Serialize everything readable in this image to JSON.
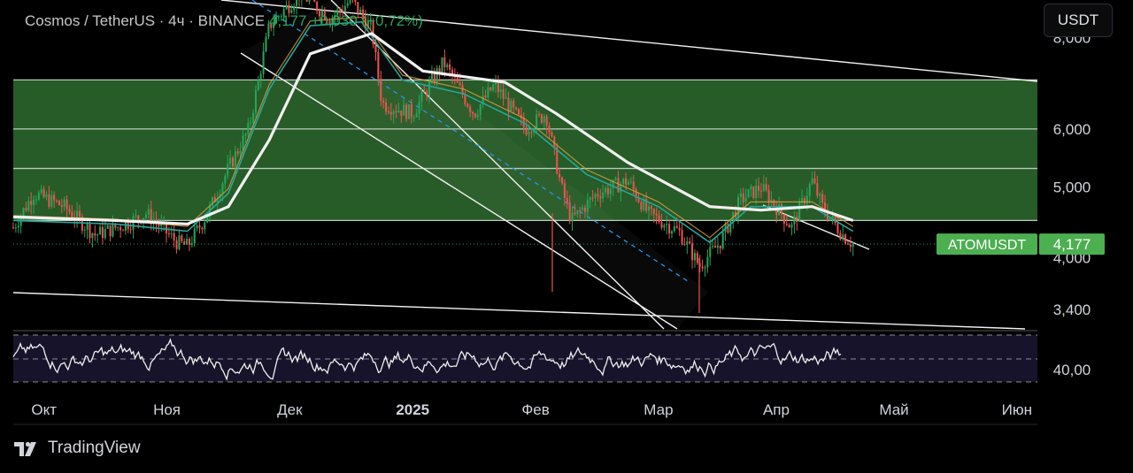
{
  "header": {
    "symbol": "Cosmos / TetherUS · 4ч · BINANCE",
    "last": "4,177",
    "change": "+0,030 (+0,72%)"
  },
  "currency_button": "USDT",
  "branding": "TradingView",
  "colors": {
    "background": "#000000",
    "zone_fill": "#2e6b2e",
    "up": "#26a65b",
    "down": "#ef5350",
    "ma_slow": "#f0f0f0",
    "ma_fast": "#26a69a",
    "ma_mid": "#e0a040",
    "trend_dashed": "#2196f3",
    "price_label": "#4caf50"
  },
  "chart_data": {
    "type": "line",
    "symbol_label": "ATOMUSDT",
    "last_price_label": "4,177",
    "y_axis_ticks": [
      "8,000",
      "6,000",
      "5,000",
      "4,000",
      "3,400"
    ],
    "y_ticks_values": [
      8000,
      6000,
      5000,
      4000,
      3400
    ],
    "ylim": [
      3200,
      9000
    ],
    "log_scale": true,
    "x_axis_ticks": [
      "Окт",
      "Ноя",
      "Дек",
      "2025",
      "Фев",
      "Мар",
      "Апр",
      "Май",
      "Июн"
    ],
    "x_ticks_t": [
      0.03,
      0.15,
      0.27,
      0.39,
      0.51,
      0.63,
      0.745,
      0.86,
      0.98
    ],
    "indicator": {
      "name": "RSI",
      "tick_label": "40,00",
      "tick_value": 40
    },
    "zones": [
      {
        "from": 4500,
        "to": 5300
      },
      {
        "from": 5300,
        "to": 6000
      },
      {
        "from": 6000,
        "to": 7000
      }
    ],
    "key_points": [
      {
        "t": 0.0,
        "p": 4400
      },
      {
        "t": 0.02,
        "p": 4900
      },
      {
        "t": 0.05,
        "p": 4700
      },
      {
        "t": 0.08,
        "p": 4300
      },
      {
        "t": 0.11,
        "p": 4450
      },
      {
        "t": 0.13,
        "p": 4600
      },
      {
        "t": 0.16,
        "p": 4200
      },
      {
        "t": 0.17,
        "p": 4150
      },
      {
        "t": 0.19,
        "p": 4600
      },
      {
        "t": 0.21,
        "p": 5300
      },
      {
        "t": 0.23,
        "p": 6000
      },
      {
        "t": 0.25,
        "p": 8300
      },
      {
        "t": 0.28,
        "p": 9200
      },
      {
        "t": 0.31,
        "p": 8500
      },
      {
        "t": 0.33,
        "p": 9000
      },
      {
        "t": 0.35,
        "p": 8200
      },
      {
        "t": 0.36,
        "p": 6500
      },
      {
        "t": 0.39,
        "p": 6300
      },
      {
        "t": 0.42,
        "p": 7400
      },
      {
        "t": 0.45,
        "p": 6300
      },
      {
        "t": 0.47,
        "p": 6900
      },
      {
        "t": 0.5,
        "p": 6000
      },
      {
        "t": 0.52,
        "p": 6300
      },
      {
        "t": 0.535,
        "p": 5000
      },
      {
        "t": 0.545,
        "p": 4500
      },
      {
        "t": 0.57,
        "p": 4900
      },
      {
        "t": 0.6,
        "p": 5100
      },
      {
        "t": 0.62,
        "p": 4600
      },
      {
        "t": 0.65,
        "p": 4350
      },
      {
        "t": 0.67,
        "p": 3900
      },
      {
        "t": 0.69,
        "p": 4200
      },
      {
        "t": 0.71,
        "p": 4800
      },
      {
        "t": 0.73,
        "p": 5000
      },
      {
        "t": 0.75,
        "p": 4600
      },
      {
        "t": 0.76,
        "p": 4400
      },
      {
        "t": 0.78,
        "p": 5100
      },
      {
        "t": 0.79,
        "p": 4700
      },
      {
        "t": 0.81,
        "p": 4300
      },
      {
        "t": 0.82,
        "p": 4177
      }
    ],
    "moving_averages": {
      "slow": [
        {
          "t": 0.0,
          "p": 4550
        },
        {
          "t": 0.1,
          "p": 4500
        },
        {
          "t": 0.17,
          "p": 4450
        },
        {
          "t": 0.21,
          "p": 4700
        },
        {
          "t": 0.25,
          "p": 5800
        },
        {
          "t": 0.29,
          "p": 7600
        },
        {
          "t": 0.35,
          "p": 8100
        },
        {
          "t": 0.4,
          "p": 7200
        },
        {
          "t": 0.48,
          "p": 6950
        },
        {
          "t": 0.53,
          "p": 6300
        },
        {
          "t": 0.6,
          "p": 5400
        },
        {
          "t": 0.68,
          "p": 4700
        },
        {
          "t": 0.73,
          "p": 4650
        },
        {
          "t": 0.78,
          "p": 4700
        },
        {
          "t": 0.82,
          "p": 4500
        }
      ],
      "fast": [
        {
          "t": 0.0,
          "p": 4500
        },
        {
          "t": 0.1,
          "p": 4450
        },
        {
          "t": 0.17,
          "p": 4350
        },
        {
          "t": 0.21,
          "p": 4900
        },
        {
          "t": 0.25,
          "p": 6800
        },
        {
          "t": 0.29,
          "p": 8300
        },
        {
          "t": 0.34,
          "p": 8400
        },
        {
          "t": 0.38,
          "p": 7000
        },
        {
          "t": 0.44,
          "p": 6700
        },
        {
          "t": 0.5,
          "p": 6100
        },
        {
          "t": 0.56,
          "p": 5200
        },
        {
          "t": 0.63,
          "p": 4700
        },
        {
          "t": 0.68,
          "p": 4200
        },
        {
          "t": 0.72,
          "p": 4700
        },
        {
          "t": 0.78,
          "p": 4700
        },
        {
          "t": 0.82,
          "p": 4350
        }
      ]
    }
  }
}
